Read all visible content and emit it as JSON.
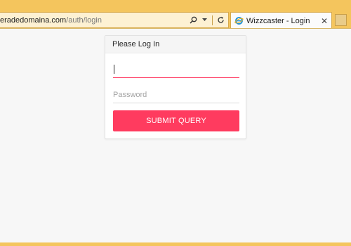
{
  "browser": {
    "address": {
      "domain": "eradedomaina.com",
      "path": "/auth/login"
    },
    "address_icons": [
      "search-icon",
      "dropdown-arrow-icon",
      "refresh-icon"
    ],
    "tab": {
      "title": "Wizzcaster - Login",
      "icon": "ie-page-icon",
      "close_glyph": "✕"
    },
    "new_tab_icon": "new-tab-icon"
  },
  "login": {
    "header": "Please Log In",
    "username": {
      "value": "",
      "placeholder": ""
    },
    "password": {
      "value": "",
      "placeholder": "Password"
    },
    "submit_label": "SUBMIT QUERY"
  },
  "colors": {
    "chrome": "#f4c55d",
    "accent": "#ff3b5f",
    "page_bg": "#f7f7f7"
  }
}
